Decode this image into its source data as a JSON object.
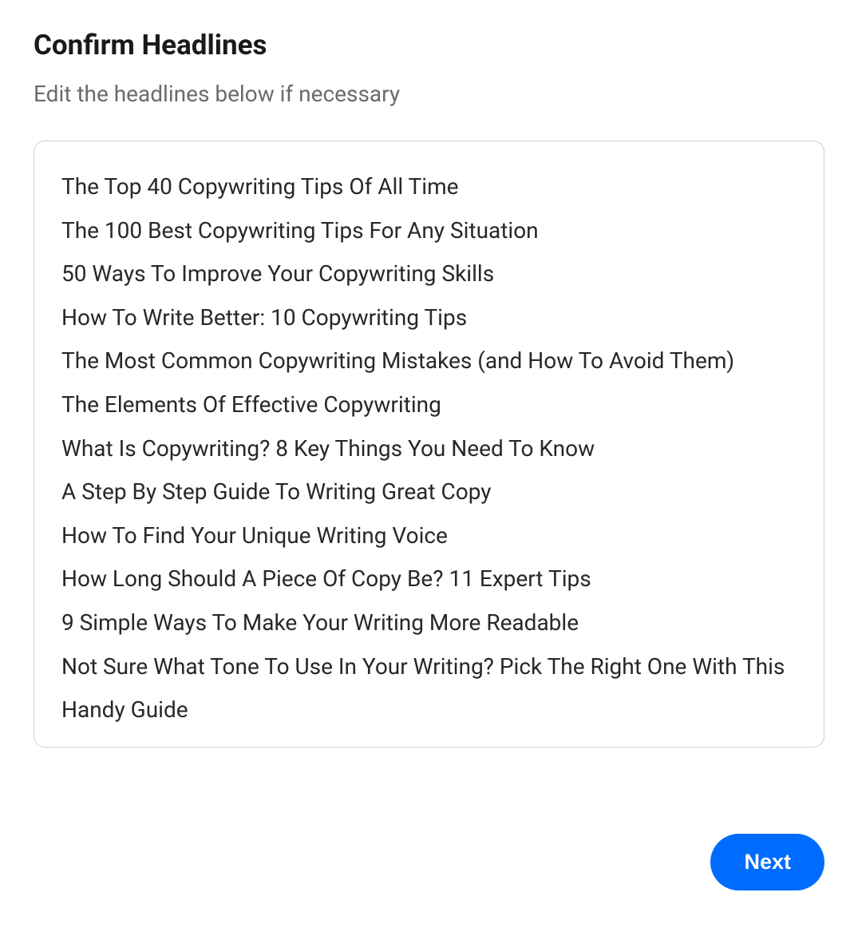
{
  "header": {
    "title": "Confirm Headlines",
    "subtitle": "Edit the headlines below if necessary"
  },
  "headlines": [
    "The Top 40 Copywriting Tips Of All Time",
    "The 100 Best Copywriting Tips For Any Situation",
    "50 Ways To Improve Your Copywriting Skills",
    "How To Write Better: 10 Copywriting Tips",
    "The Most Common Copywriting Mistakes (and How To Avoid Them)",
    "The Elements Of Effective Copywriting",
    "What Is Copywriting? 8 Key Things You Need To Know",
    "A Step By Step Guide To Writing Great Copy",
    "How To Find Your Unique Writing Voice",
    "How Long Should A Piece Of Copy Be? 11 Expert Tips",
    "9 Simple Ways To Make Your Writing More Readable",
    "Not Sure What Tone To Use In Your Writing? Pick The Right One With This Handy Guide"
  ],
  "footer": {
    "next_label": "Next"
  }
}
